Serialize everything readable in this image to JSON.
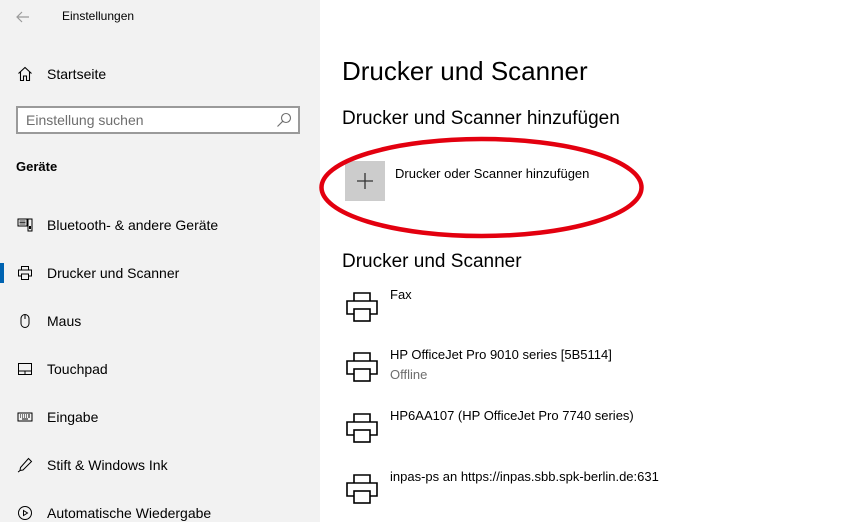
{
  "window": {
    "title": "Einstellungen"
  },
  "sidebar": {
    "home_label": "Startseite",
    "search": {
      "placeholder": "Einstellung suchen",
      "value": ""
    },
    "section_title": "Geräte",
    "items": [
      {
        "label": "Bluetooth- & andere Geräte",
        "icon": "bluetooth-devices-icon",
        "selected": false
      },
      {
        "label": "Drucker und Scanner",
        "icon": "printer-icon",
        "selected": true
      },
      {
        "label": "Maus",
        "icon": "mouse-icon",
        "selected": false
      },
      {
        "label": "Touchpad",
        "icon": "touchpad-icon",
        "selected": false
      },
      {
        "label": "Eingabe",
        "icon": "keyboard-icon",
        "selected": false
      },
      {
        "label": "Stift & Windows Ink",
        "icon": "pen-icon",
        "selected": false
      },
      {
        "label": "Automatische Wiedergabe",
        "icon": "autoplay-icon",
        "selected": false
      }
    ]
  },
  "main": {
    "title": "Drucker und Scanner",
    "add_section": {
      "heading": "Drucker und Scanner hinzufügen",
      "button_label": "Drucker oder Scanner hinzufügen"
    },
    "list_section": {
      "heading": "Drucker und Scanner",
      "printers": [
        {
          "name": "Fax",
          "status": ""
        },
        {
          "name": "HP OfficeJet Pro 9010 series [5B5114]",
          "status": "Offline"
        },
        {
          "name": "HP6AA107 (HP OfficeJet Pro 7740 series)",
          "status": ""
        },
        {
          "name": "inpas-ps an https://inpas.sbb.spk-berlin.de:631",
          "status": ""
        }
      ]
    }
  },
  "colors": {
    "sidebar_bg": "#f2f2f2",
    "accent": "#0063b1",
    "highlight_annotation": "#e3000f",
    "add_button_bg": "#cccccc",
    "secondary_text": "#6e6e6e"
  }
}
